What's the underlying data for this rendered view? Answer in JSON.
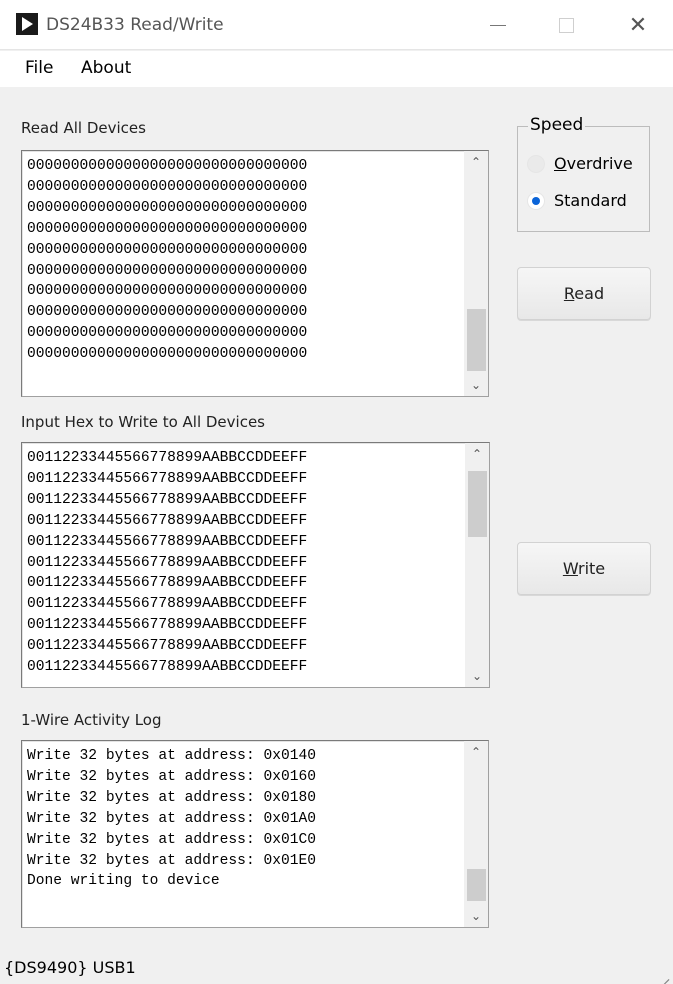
{
  "window": {
    "title": "DS24B33 Read/Write",
    "close_glyph": "✕"
  },
  "menu": {
    "file": "File",
    "about": "About"
  },
  "read_section": {
    "label": "Read All Devices",
    "lines": [
      "00000000000000000000000000000000",
      "00000000000000000000000000000000",
      "00000000000000000000000000000000",
      "00000000000000000000000000000000",
      "00000000000000000000000000000000",
      "00000000000000000000000000000000",
      "00000000000000000000000000000000",
      "00000000000000000000000000000000",
      "00000000000000000000000000000000",
      "00000000000000000000000000000000"
    ]
  },
  "write_section": {
    "label": "Input Hex to Write to All Devices",
    "lines": [
      "00112233445566778899AABBCCDDEEFF",
      "00112233445566778899AABBCCDDEEFF",
      "00112233445566778899AABBCCDDEEFF",
      "00112233445566778899AABBCCDDEEFF",
      "00112233445566778899AABBCCDDEEFF",
      "00112233445566778899AABBCCDDEEFF",
      "00112233445566778899AABBCCDDEEFF",
      "00112233445566778899AABBCCDDEEFF",
      "00112233445566778899AABBCCDDEEFF",
      "00112233445566778899AABBCCDDEEFF",
      "00112233445566778899AABBCCDDEEFF"
    ]
  },
  "log_section": {
    "label": "1-Wire Activity Log",
    "lines": [
      "Write 32 bytes at address: 0x0140",
      "Write 32 bytes at address: 0x0160",
      "Write 32 bytes at address: 0x0180",
      "Write 32 bytes at address: 0x01A0",
      "Write 32 bytes at address: 0x01C0",
      "Write 32 bytes at address: 0x01E0",
      "Done writing to device"
    ]
  },
  "speed": {
    "legend": "Speed",
    "overdrive_first": "O",
    "overdrive_rest": "verdrive",
    "standard": "Standard",
    "selected": "Standard"
  },
  "buttons": {
    "read_first": "R",
    "read_rest": "ead",
    "write_first": "W",
    "write_rest": "rite"
  },
  "status": {
    "adapter": "{DS9490} USB1"
  },
  "colors": {
    "accent": "#0a64d8",
    "background": "#f0f0f0"
  }
}
